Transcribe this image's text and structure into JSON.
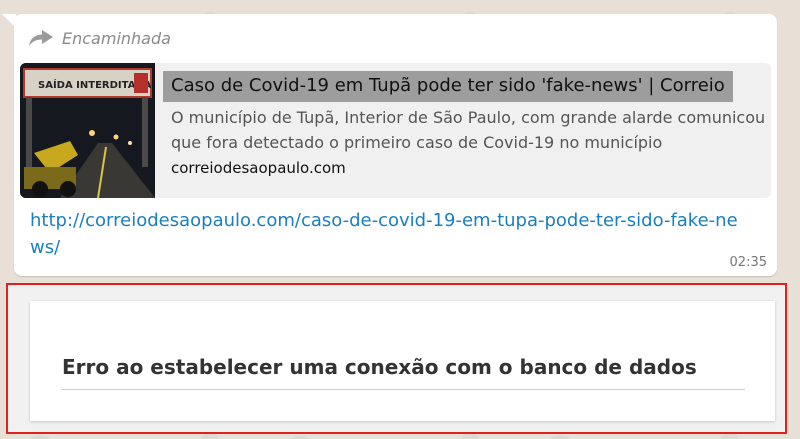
{
  "message": {
    "forwarded_label": "Encaminhada",
    "preview": {
      "thumbnail_sign_text": "SAÍDA INTERDITADA",
      "title": "Caso de Covid-19 em Tupã pode ter sido 'fake-news' | Correio",
      "description": "O município de Tupã, Interior de São Paulo, com grande alarde comunicou que fora detectado o primeiro caso de Covid-19 no município",
      "domain": "correiodesaopaulo.com"
    },
    "link": "http://correiodesaopaulo.com/caso-de-covid-19-em-tupa-pode-ter-sido-fake-news/",
    "time": "02:35"
  },
  "error_page": {
    "message": "Erro ao estabelecer uma conexão com o banco de dados"
  },
  "colors": {
    "link": "#1a7fc0",
    "highlight_border": "#e0211f",
    "title_highlight": "#9d9d9d"
  },
  "icons": {
    "forwarded": "forward-arrow-icon"
  }
}
